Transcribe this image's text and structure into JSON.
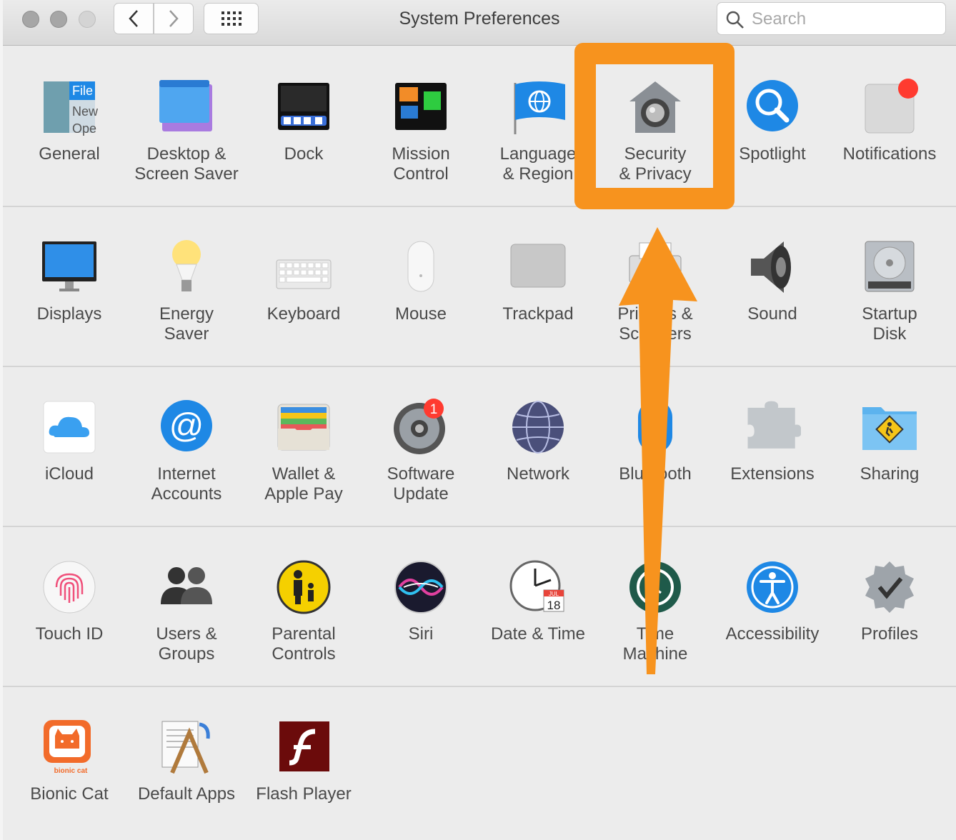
{
  "window": {
    "title": "System Preferences"
  },
  "search": {
    "placeholder": "Search"
  },
  "rows": [
    [
      {
        "label1": "General",
        "label2": ""
      },
      {
        "label1": "Desktop &",
        "label2": "Screen Saver"
      },
      {
        "label1": "Dock",
        "label2": ""
      },
      {
        "label1": "Mission",
        "label2": "Control"
      },
      {
        "label1": "Language",
        "label2": "& Region"
      },
      {
        "label1": "Security",
        "label2": "& Privacy"
      },
      {
        "label1": "Spotlight",
        "label2": ""
      },
      {
        "label1": "Notifications",
        "label2": ""
      }
    ],
    [
      {
        "label1": "Displays",
        "label2": ""
      },
      {
        "label1": "Energy",
        "label2": "Saver"
      },
      {
        "label1": "Keyboard",
        "label2": ""
      },
      {
        "label1": "Mouse",
        "label2": ""
      },
      {
        "label1": "Trackpad",
        "label2": ""
      },
      {
        "label1": "Printers &",
        "label2": "Scanners"
      },
      {
        "label1": "Sound",
        "label2": ""
      },
      {
        "label1": "Startup",
        "label2": "Disk"
      }
    ],
    [
      {
        "label1": "iCloud",
        "label2": ""
      },
      {
        "label1": "Internet",
        "label2": "Accounts"
      },
      {
        "label1": "Wallet &",
        "label2": "Apple Pay"
      },
      {
        "label1": "Software",
        "label2": "Update"
      },
      {
        "label1": "Network",
        "label2": ""
      },
      {
        "label1": "Bluetooth",
        "label2": ""
      },
      {
        "label1": "Extensions",
        "label2": ""
      },
      {
        "label1": "Sharing",
        "label2": ""
      }
    ],
    [
      {
        "label1": "Touch ID",
        "label2": ""
      },
      {
        "label1": "Users &",
        "label2": "Groups"
      },
      {
        "label1": "Parental",
        "label2": "Controls"
      },
      {
        "label1": "Siri",
        "label2": ""
      },
      {
        "label1": "Date & Time",
        "label2": ""
      },
      {
        "label1": "Time",
        "label2": "Machine"
      },
      {
        "label1": "Accessibility",
        "label2": ""
      },
      {
        "label1": "Profiles",
        "label2": ""
      }
    ],
    [
      {
        "label1": "Bionic Cat",
        "label2": ""
      },
      {
        "label1": "Default Apps",
        "label2": ""
      },
      {
        "label1": "Flash Player",
        "label2": ""
      }
    ]
  ],
  "icons": {
    "general": {
      "text1": "File",
      "text2": "New",
      "text3": "Ope"
    },
    "software_update_badge": "1",
    "calendar_month": "JUL",
    "calendar_day": "18",
    "bionic_cat_text": "bionic cat"
  },
  "colors": {
    "highlight": "#f7931e",
    "badge": "#ff3b30",
    "accent_blue": "#1e88e5"
  }
}
